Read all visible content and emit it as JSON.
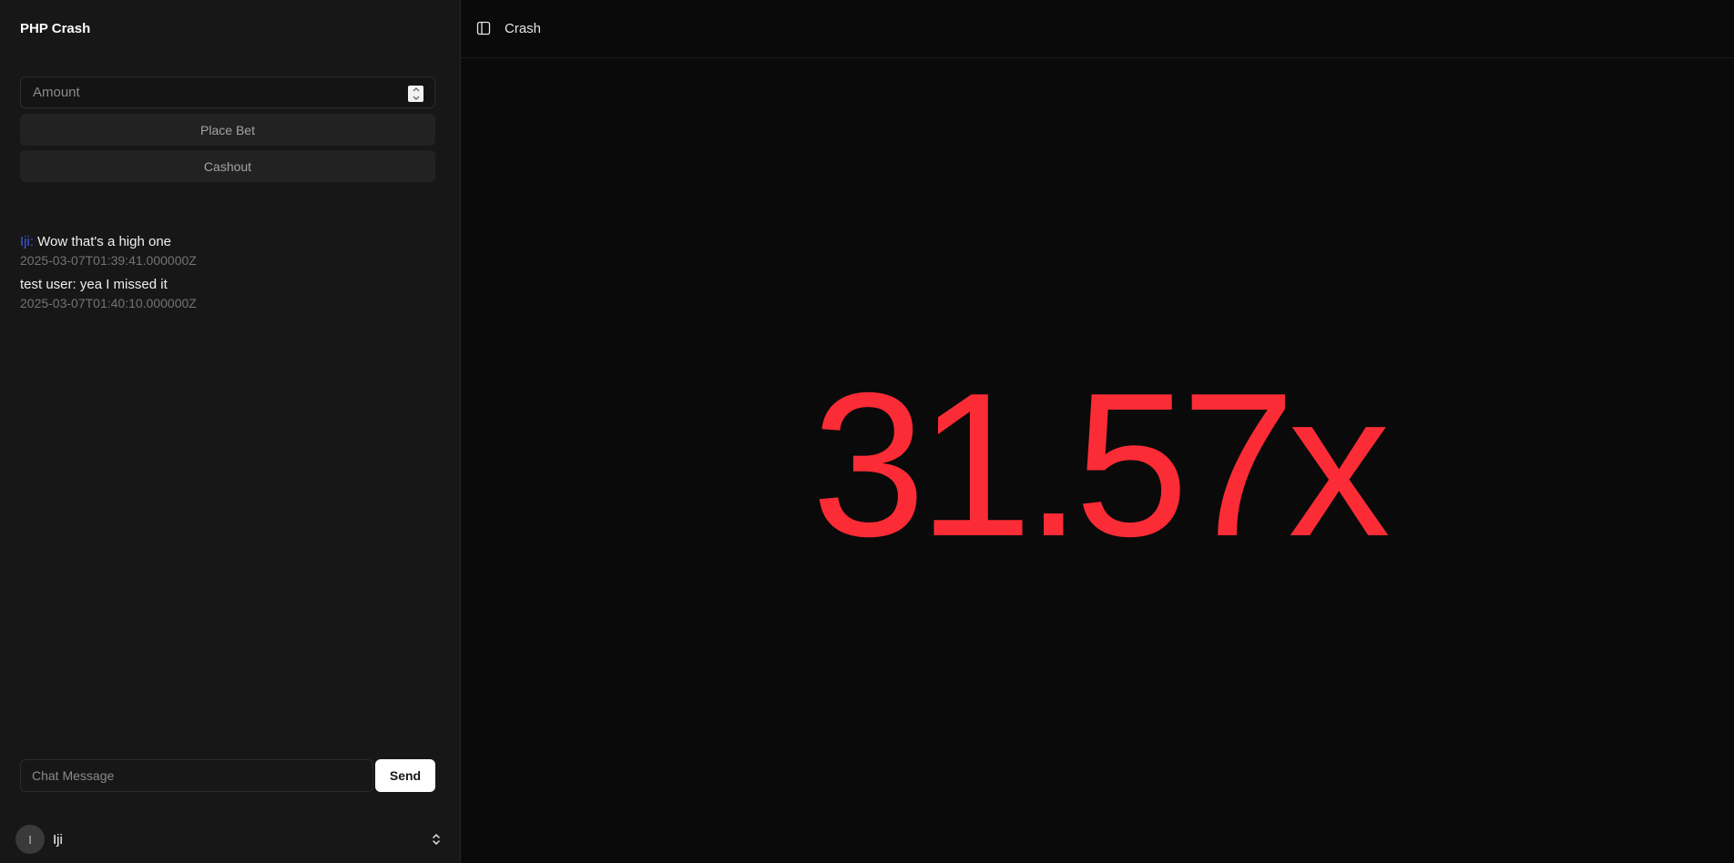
{
  "app": {
    "title": "PHP Crash"
  },
  "bet": {
    "amount_placeholder": "Amount",
    "place_bet_label": "Place Bet",
    "cashout_label": "Cashout"
  },
  "chat": {
    "messages": [
      {
        "user": "Iji:",
        "text": "Wow that's a high one",
        "timestamp": "2025-03-07T01:39:41.000000Z"
      },
      {
        "user": "test user:",
        "text": "yea I missed it",
        "timestamp": "2025-03-07T01:40:10.000000Z"
      }
    ],
    "input_placeholder": "Chat Message",
    "send_label": "Send"
  },
  "user": {
    "avatar_initial": "I",
    "name": "Iji"
  },
  "header": {
    "title": "Crash"
  },
  "game": {
    "multiplier": "31.57x",
    "multiplier_color": "#fb2c36"
  },
  "colors": {
    "sidebar_bg": "#171717",
    "main_bg": "#0a0a0a",
    "chat_username_accent": "#3b5bdb"
  },
  "icons": {
    "sidebar_toggle": "panel-left-icon",
    "number_spinner": "spinner-arrows-icon",
    "user_menu": "chevrons-up-down-icon"
  }
}
